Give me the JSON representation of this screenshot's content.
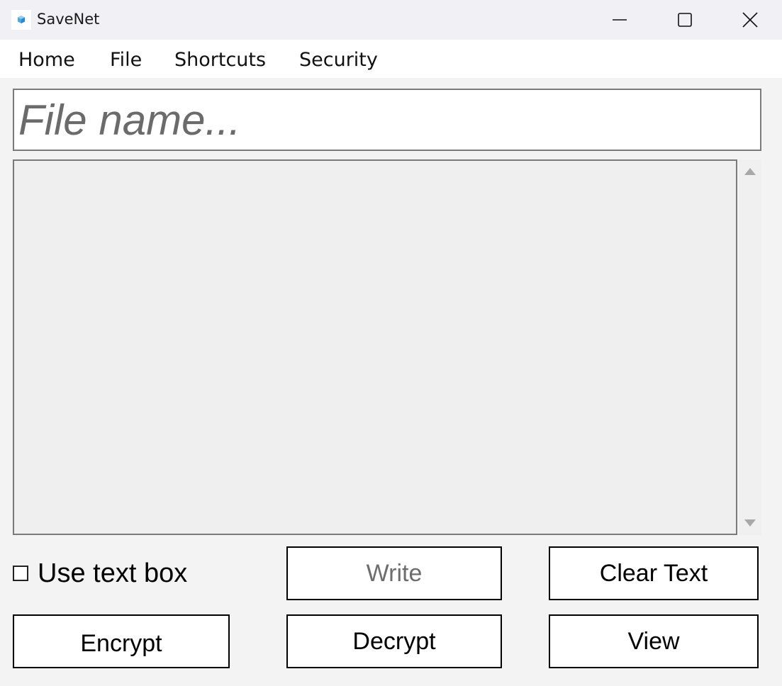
{
  "window": {
    "title": "SaveNet",
    "icon": "app-cube-icon"
  },
  "menu": {
    "items": [
      {
        "label": "Home"
      },
      {
        "label": "File"
      },
      {
        "label": "Shortcuts"
      },
      {
        "label": "Security"
      }
    ]
  },
  "filename_input": {
    "placeholder": "File name...",
    "value": ""
  },
  "text_area": {
    "value": ""
  },
  "checkbox": {
    "label": "Use text box",
    "checked": false
  },
  "buttons": {
    "write": "Write",
    "clear_text": "Clear Text",
    "encrypt": "Encrypt",
    "decrypt": "Decrypt",
    "view": "View"
  },
  "colors": {
    "background": "#f3f3f3",
    "titlebar": "#f1f0f5",
    "textarea_bg": "#efefef",
    "disabled_text": "#6d6d6d",
    "icon_accent": "#4aa8e8"
  }
}
